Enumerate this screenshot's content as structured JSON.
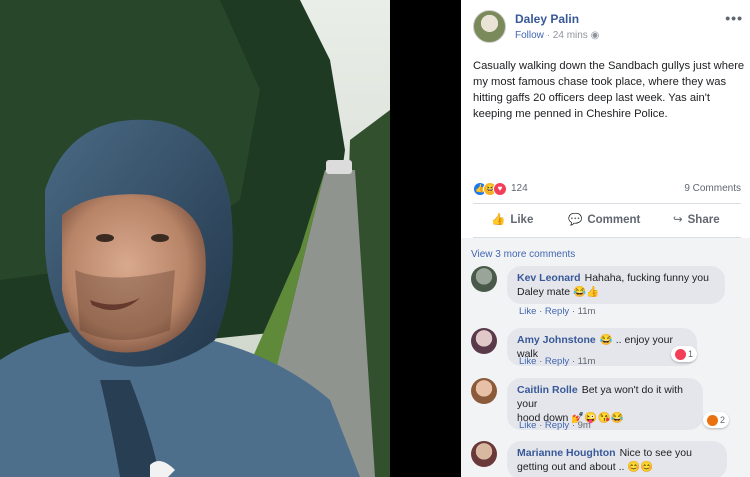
{
  "post": {
    "author": "Daley Palin",
    "follow": "Follow",
    "time": "24 mins",
    "more": "•••",
    "text": "Casually walking down the Sandbach gullys just where my most famous chase took place, where they was hitting gaffs 20 officers deep last week. Yas ain't keeping me penned in Cheshire Police.",
    "reaction_count": "124",
    "comment_count": "9 Comments"
  },
  "actions": {
    "like": "Like",
    "comment": "Comment",
    "share": "Share"
  },
  "comments_section": {
    "view_more": "View 3 more comments",
    "like_label": "Like",
    "reply_label": "Reply",
    "sep": "·",
    "items": [
      {
        "author": "Kev Leonard",
        "line1": "Hahaha, fucking funny you",
        "line2": "Daley mate 😂👍",
        "time": "11m"
      },
      {
        "author": "Amy Johnstone",
        "line1": "😂 .. enjoy your walk",
        "time": "11m",
        "badge": "1"
      },
      {
        "author": "Caitlin Rolle",
        "line1": "Bet ya won't do it with your",
        "line2": "hood down 💅😜😘😂",
        "time": "9m",
        "badge": "2"
      },
      {
        "author": "Marianne Houghton",
        "line1": "Nice to see you",
        "line2": "getting out and about .. 😊😊"
      }
    ]
  },
  "colors": {
    "link": "#385898",
    "accent": "#4267b2",
    "bg_comments": "#f2f3f5"
  }
}
